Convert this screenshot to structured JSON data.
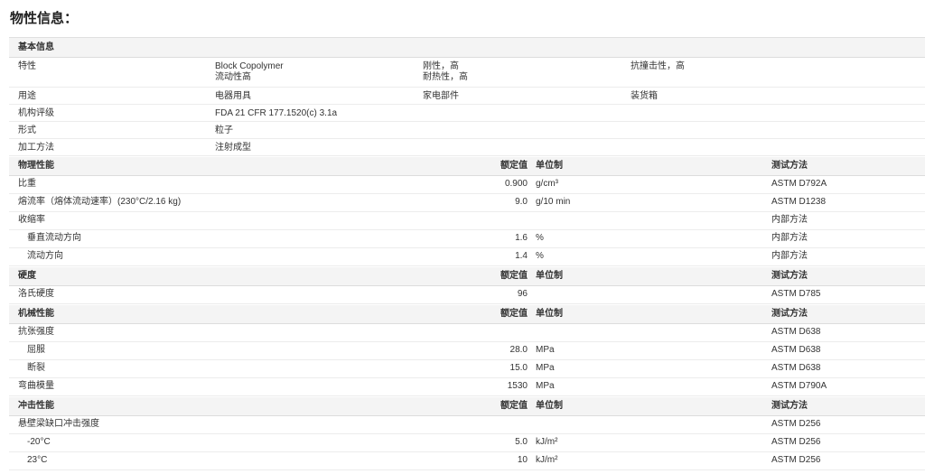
{
  "page_title": "物性信息：",
  "basic": {
    "header": "基本信息",
    "rows": [
      {
        "label": "特性",
        "c1": [
          "Block Copolymer",
          "流动性高"
        ],
        "c2": [
          "刚性，高",
          "耐热性，高"
        ],
        "c3": [
          "抗撞击性，高"
        ]
      },
      {
        "label": "用途",
        "c1": [
          "电器用具"
        ],
        "c2": [
          "家电部件"
        ],
        "c3": [
          "装货箱"
        ]
      },
      {
        "label": "机构评级",
        "c1": [
          "FDA 21 CFR 177.1520(c) 3.1a"
        ],
        "c2": [],
        "c3": []
      },
      {
        "label": "形式",
        "c1": [
          "粒子"
        ],
        "c2": [],
        "c3": []
      },
      {
        "label": "加工方法",
        "c1": [
          "注射成型"
        ],
        "c2": [],
        "c3": []
      }
    ]
  },
  "sections": [
    {
      "name": "物理性能",
      "value_header": "额定值",
      "unit_header": "单位制",
      "test_header": "测试方法",
      "rows": [
        {
          "label": "比重",
          "indent": false,
          "value": "0.900",
          "unit": "g/cm³",
          "test": "ASTM D792A"
        },
        {
          "label": "熔流率（熔体流动速率）(230°C/2.16 kg)",
          "indent": false,
          "value": "9.0",
          "unit": "g/10 min",
          "test": "ASTM D1238"
        },
        {
          "label": "收缩率",
          "indent": false,
          "value": "",
          "unit": "",
          "test": "内部方法"
        },
        {
          "label": "垂直流动方向",
          "indent": true,
          "value": "1.6",
          "unit": "%",
          "test": "内部方法"
        },
        {
          "label": "流动方向",
          "indent": true,
          "value": "1.4",
          "unit": "%",
          "test": "内部方法"
        }
      ]
    },
    {
      "name": "硬度",
      "value_header": "额定值",
      "unit_header": "单位制",
      "test_header": "测试方法",
      "rows": [
        {
          "label": "洛氏硬度",
          "indent": false,
          "value": "96",
          "unit": "",
          "test": "ASTM D785"
        }
      ]
    },
    {
      "name": "机械性能",
      "value_header": "额定值",
      "unit_header": "单位制",
      "test_header": "测试方法",
      "rows": [
        {
          "label": "抗张强度",
          "indent": false,
          "value": "",
          "unit": "",
          "test": "ASTM D638"
        },
        {
          "label": "屈服",
          "indent": true,
          "value": "28.0",
          "unit": "MPa",
          "test": "ASTM D638"
        },
        {
          "label": "断裂",
          "indent": true,
          "value": "15.0",
          "unit": "MPa",
          "test": "ASTM D638"
        },
        {
          "label": "弯曲模量",
          "indent": false,
          "value": "1530",
          "unit": "MPa",
          "test": "ASTM D790A"
        }
      ]
    },
    {
      "name": "冲击性能",
      "value_header": "额定值",
      "unit_header": "单位制",
      "test_header": "测试方法",
      "rows": [
        {
          "label": "悬壁梁缺口冲击强度",
          "indent": false,
          "value": "",
          "unit": "",
          "test": "ASTM D256"
        },
        {
          "label": "-20°C",
          "indent": true,
          "value": "5.0",
          "unit": "kJ/m²",
          "test": "ASTM D256"
        },
        {
          "label": "23°C",
          "indent": true,
          "value": "10",
          "unit": "kJ/m²",
          "test": "ASTM D256"
        }
      ]
    }
  ]
}
